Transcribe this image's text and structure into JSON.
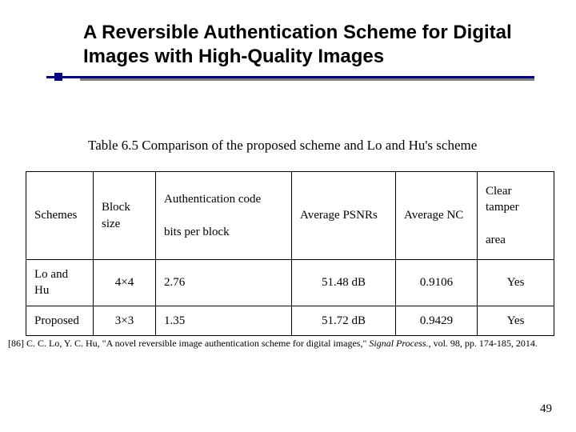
{
  "title": "A Reversible Authentication Scheme for Digital Images with High-Quality Images",
  "caption": "Table 6.5 Comparison of the proposed scheme and Lo and Hu's scheme",
  "headers": {
    "schemes": "Schemes",
    "block": "Block size",
    "auth_l1": "Authentication code",
    "auth_l2": "bits per block",
    "psnr": "Average PSNRs",
    "nc": "Average NC",
    "clear_l1": "Clear tamper",
    "clear_l2": "area"
  },
  "rows": [
    {
      "scheme": "Lo and Hu",
      "block": "4×4",
      "auth": "2.76",
      "psnr": "51.48 dB",
      "nc": "0.9106",
      "clear": "Yes"
    },
    {
      "scheme": "Proposed",
      "block": "3×3",
      "auth": "1.35",
      "psnr": "51.72 dB",
      "nc": "0.9429",
      "clear": "Yes"
    }
  ],
  "reference": {
    "label": "[86] C. C. Lo, Y. C. Hu, \"A novel reversible image authentication scheme for digital images,\" ",
    "journal": "Signal Process.",
    "rest": ", vol. 98, pp. 174-185, 2014."
  },
  "page": "49",
  "chart_data": {
    "type": "table",
    "title": "Table 6.5 Comparison of the proposed scheme and Lo and Hu's scheme",
    "columns": [
      "Schemes",
      "Block size",
      "Authentication code bits per block",
      "Average PSNRs",
      "Average NC",
      "Clear tamper area"
    ],
    "rows": [
      [
        "Lo and Hu",
        "4×4",
        2.76,
        "51.48 dB",
        0.9106,
        "Yes"
      ],
      [
        "Proposed",
        "3×3",
        1.35,
        "51.72 dB",
        0.9429,
        "Yes"
      ]
    ]
  }
}
